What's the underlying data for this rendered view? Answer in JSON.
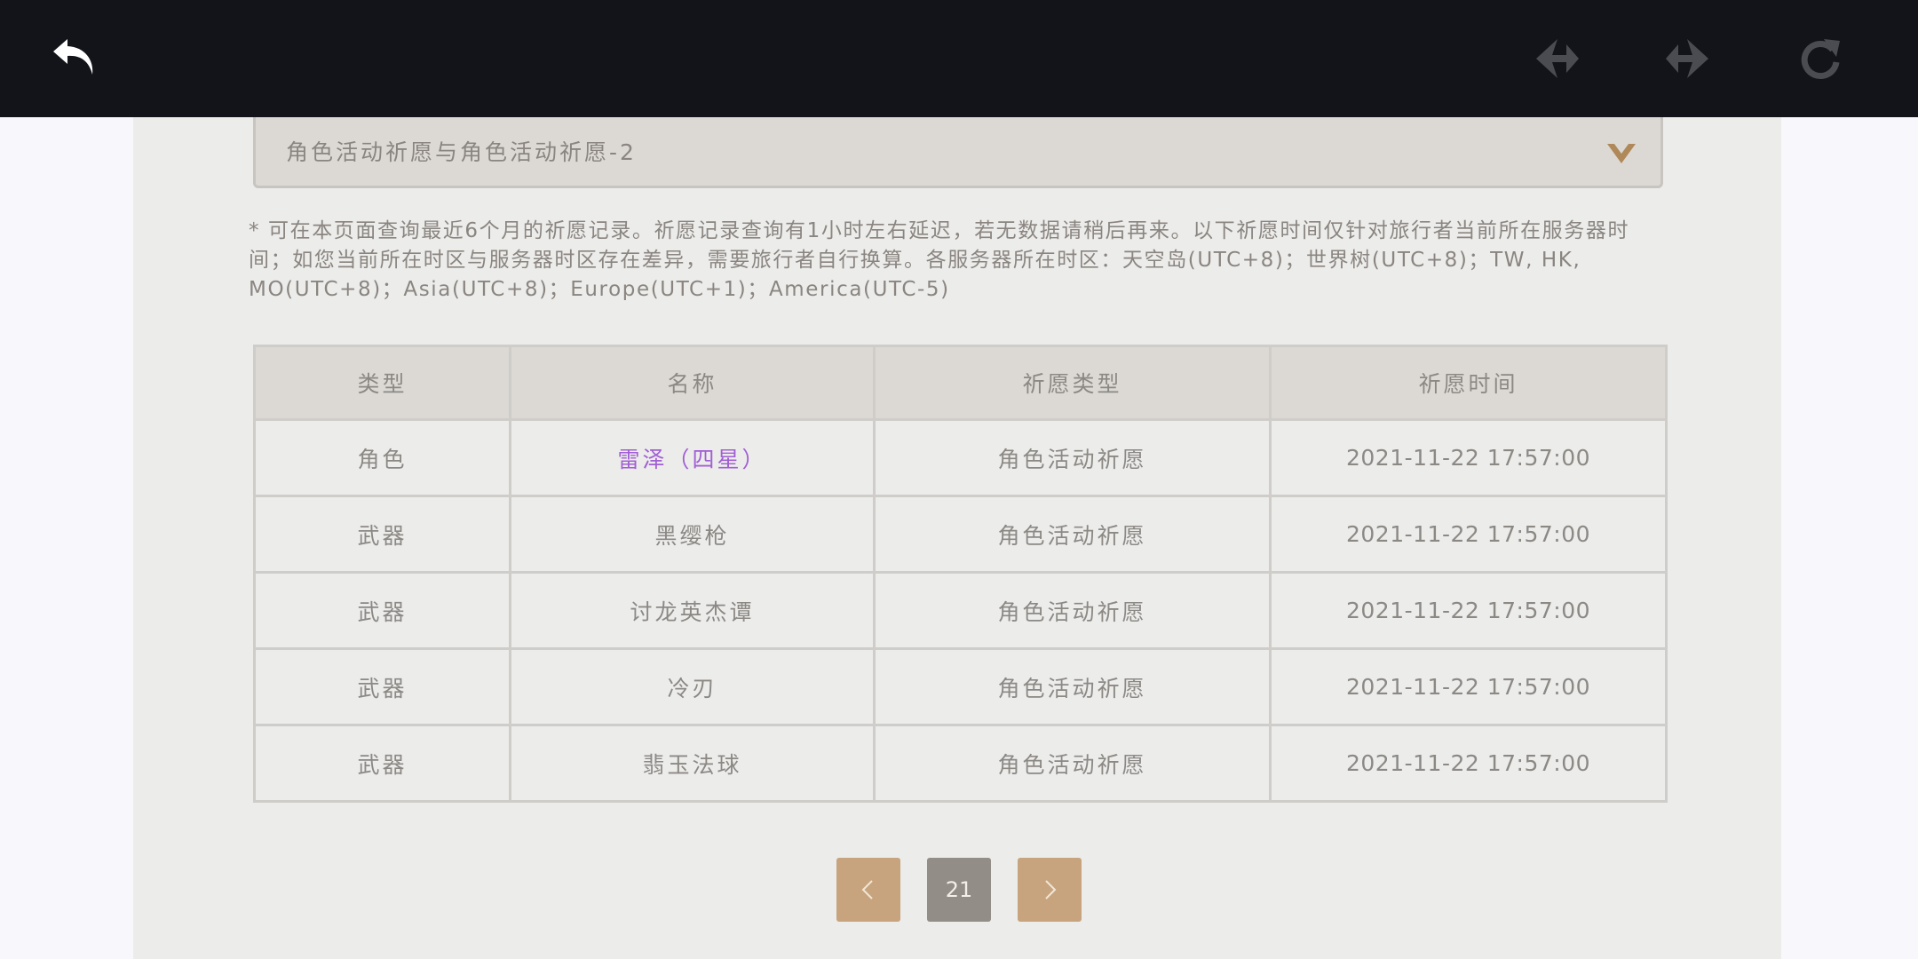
{
  "topbar": {
    "back_icon": "back-arrow-icon",
    "prev_icon": "diamond-arrow-left-icon",
    "next_icon": "diamond-arrow-right-icon",
    "refresh_icon": "refresh-icon",
    "colors": {
      "bg": "#121419",
      "back": "#ffffff",
      "nav_disabled": "#4a4c52"
    }
  },
  "filter": {
    "selected": "角色活动祈愿与角色活动祈愿-2",
    "icon": "triangle-dropdown-icon"
  },
  "notice": "* 可在本页面查询最近6个月的祈愿记录。祈愿记录查询有1小时左右延迟，若无数据请稍后再来。以下祈愿时间仅针对旅行者当前所在服务器时间；如您当前所在时区与服务器时区存在差异，需要旅行者自行换算。各服务器所在时区：天空岛(UTC+8)；世界树(UTC+8)；TW, HK, MO(UTC+8)；Asia(UTC+8)；Europe(UTC+1)；America(UTC-5)",
  "table": {
    "headers": [
      "类型",
      "名称",
      "祈愿类型",
      "祈愿时间"
    ],
    "rows": [
      {
        "type": "角色",
        "name": "雷泽（四星）",
        "wish_type": "角色活动祈愿",
        "time": "2021-11-22 17:57:00",
        "highlight": "#a25fd4"
      },
      {
        "type": "武器",
        "name": "黑缨枪",
        "wish_type": "角色活动祈愿",
        "time": "2021-11-22 17:57:00"
      },
      {
        "type": "武器",
        "name": "讨龙英杰谭",
        "wish_type": "角色活动祈愿",
        "time": "2021-11-22 17:57:00"
      },
      {
        "type": "武器",
        "name": "冷刃",
        "wish_type": "角色活动祈愿",
        "time": "2021-11-22 17:57:00"
      },
      {
        "type": "武器",
        "name": "翡玉法球",
        "wish_type": "角色活动祈愿",
        "time": "2021-11-22 17:57:00"
      }
    ]
  },
  "pagination": {
    "current_page": "21",
    "prev_icon": "chevron-left-icon",
    "next_icon": "chevron-right-icon",
    "colors": {
      "arrow_bg": "#c7a47e",
      "current_bg": "#928d86"
    }
  }
}
